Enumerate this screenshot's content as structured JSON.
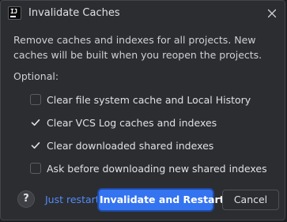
{
  "dialog": {
    "title": "Invalidate Caches",
    "app_icon_text": "IJ",
    "description": "Remove caches and indexes for all projects. New caches will be built when you reopen the projects.",
    "optional_label": "Optional:",
    "options": [
      {
        "label": "Clear file system cache and Local History",
        "checked": false
      },
      {
        "label": "Clear VCS Log caches and indexes",
        "checked": true
      },
      {
        "label": "Clear downloaded shared indexes",
        "checked": true
      },
      {
        "label": "Ask before downloading new shared indexes",
        "checked": false
      }
    ],
    "help_label": "?",
    "just_restart_label": "Just restart",
    "primary_button_label": "Invalidate and Restart",
    "cancel_button_label": "Cancel"
  },
  "colors": {
    "accent": "#3574f0",
    "link": "#548af7",
    "background": "#2b2d30"
  }
}
